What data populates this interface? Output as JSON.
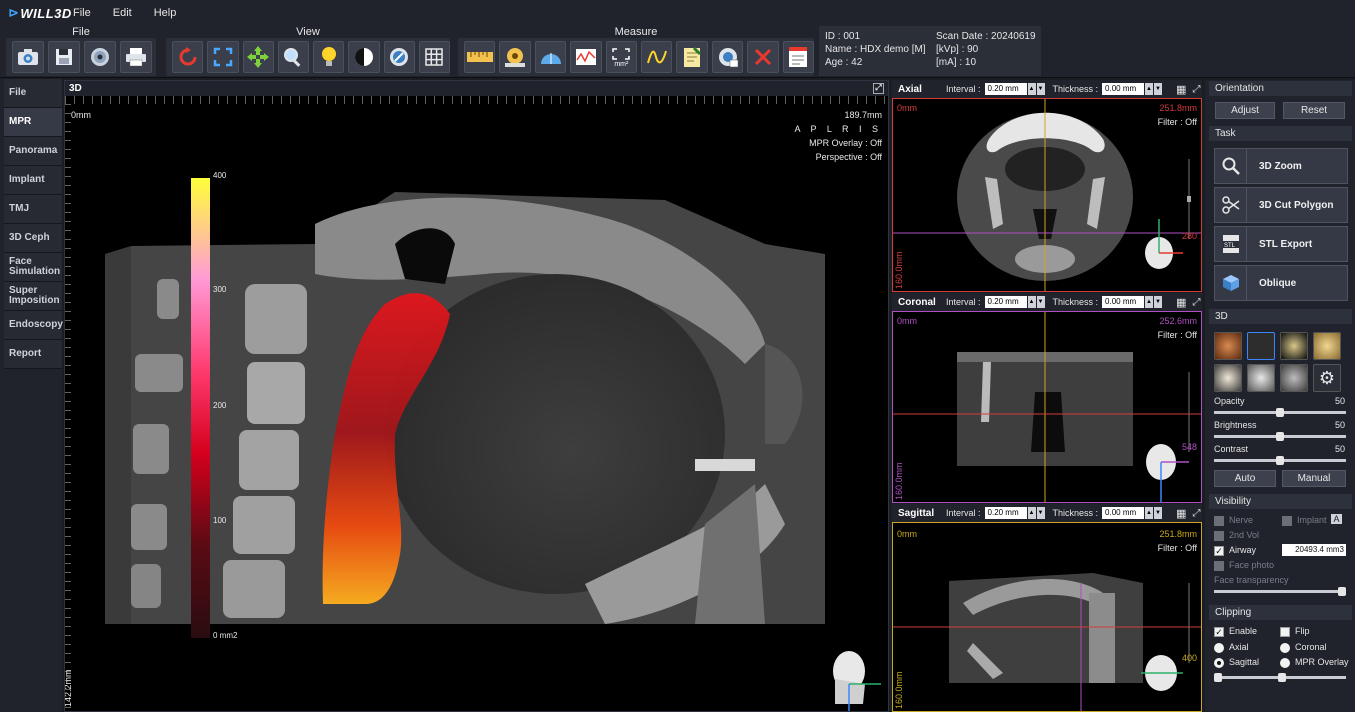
{
  "app": {
    "logo": "WILL3D"
  },
  "menu": [
    "File",
    "Edit",
    "Help"
  ],
  "toolbar": {
    "groups": [
      {
        "title": "File",
        "icons": [
          "camera-icon",
          "save-icon",
          "disc-icon",
          "print-icon"
        ]
      },
      {
        "title": "View",
        "icons": [
          "reset-rotate-icon",
          "fit-icon",
          "pan-icon",
          "zoom-icon",
          "light-icon",
          "contrast-icon",
          "invert-icon",
          "grid-icon"
        ]
      },
      {
        "title": "Measure",
        "icons": [
          "ruler-icon",
          "tape-icon",
          "angle-icon",
          "profile-icon",
          "area-icon",
          "freehand-icon",
          "note-icon",
          "analysis-icon",
          "delete-icon",
          "report-icon"
        ]
      }
    ],
    "area_unit": "mm²"
  },
  "patient": {
    "id": "ID : 001",
    "name": "Name : HDX demo [M]",
    "age": "Age : 42",
    "scan_date": "Scan Date : 20240619",
    "kvp": "[kVp] : 90",
    "ma": "[mA] : 10"
  },
  "nav": [
    "File",
    "MPR",
    "Panorama",
    "Implant",
    "TMJ",
    "3D Ceph",
    "Face Simulation",
    "Super Imposition",
    "Endoscopy",
    "Report"
  ],
  "nav_active": "MPR",
  "view3d": {
    "title": "3D",
    "top_left": "0mm",
    "top_right": "189.7mm",
    "orientation": "A P L R I S",
    "mpr_overlay": "MPR Overlay : Off",
    "perspective": "Perspective : Off",
    "bottom_left": "142.2mm",
    "colorbar": {
      "labels": [
        "400",
        "300",
        "200",
        "100",
        "0 mm2"
      ]
    }
  },
  "slices": [
    {
      "name": "Axial",
      "interval_label": "Interval :",
      "interval": "0.20 mm",
      "thickness_label": "Thickness :",
      "thickness": "0.00 mm",
      "top_left": "0mm",
      "top_right": "251.8mm",
      "filter": "Filter : Off",
      "index": "280",
      "side": "160.0mm",
      "color": "#d23c3c"
    },
    {
      "name": "Coronal",
      "interval_label": "Interval :",
      "interval": "0.20 mm",
      "thickness_label": "Thickness :",
      "thickness": "0.00 mm",
      "top_left": "0mm",
      "top_right": "252.6mm",
      "filter": "Filter : Off",
      "index": "548",
      "side": "160.0mm",
      "color": "#b04fc4"
    },
    {
      "name": "Sagittal",
      "interval_label": "Interval :",
      "interval": "0.20 mm",
      "thickness_label": "Thickness :",
      "thickness": "0.00 mm",
      "top_left": "0mm",
      "top_right": "251.8mm",
      "filter": "Filter : Off",
      "index": "400",
      "side": "160.0mm",
      "color": "#c8a81e"
    }
  ],
  "panel": {
    "orientation": {
      "title": "Orientation",
      "adjust": "Adjust",
      "reset": "Reset"
    },
    "task": {
      "title": "Task",
      "items": [
        "3D Zoom",
        "3D Cut Polygon",
        "STL Export",
        "Oblique"
      ]
    },
    "threed": {
      "title": "3D",
      "opacity_label": "Opacity",
      "opacity": "50",
      "brightness_label": "Brightness",
      "brightness": "50",
      "contrast_label": "Contrast",
      "contrast": "50",
      "auto": "Auto",
      "manual": "Manual"
    },
    "visibility": {
      "title": "Visibility",
      "nerve": "Nerve",
      "implant": "Implant",
      "implant_badge": "A",
      "second_vol": "2nd Vol",
      "airway": "Airway",
      "airway_value": "20493.4 mm3",
      "face_photo": "Face photo",
      "face_transparency": "Face transparency"
    },
    "clipping": {
      "title": "Clipping",
      "enable": "Enable",
      "flip": "Flip",
      "axial": "Axial",
      "coronal": "Coronal",
      "sagittal": "Sagittal",
      "mpr_overlay": "MPR Overlay",
      "selected": "Sagittal"
    }
  }
}
